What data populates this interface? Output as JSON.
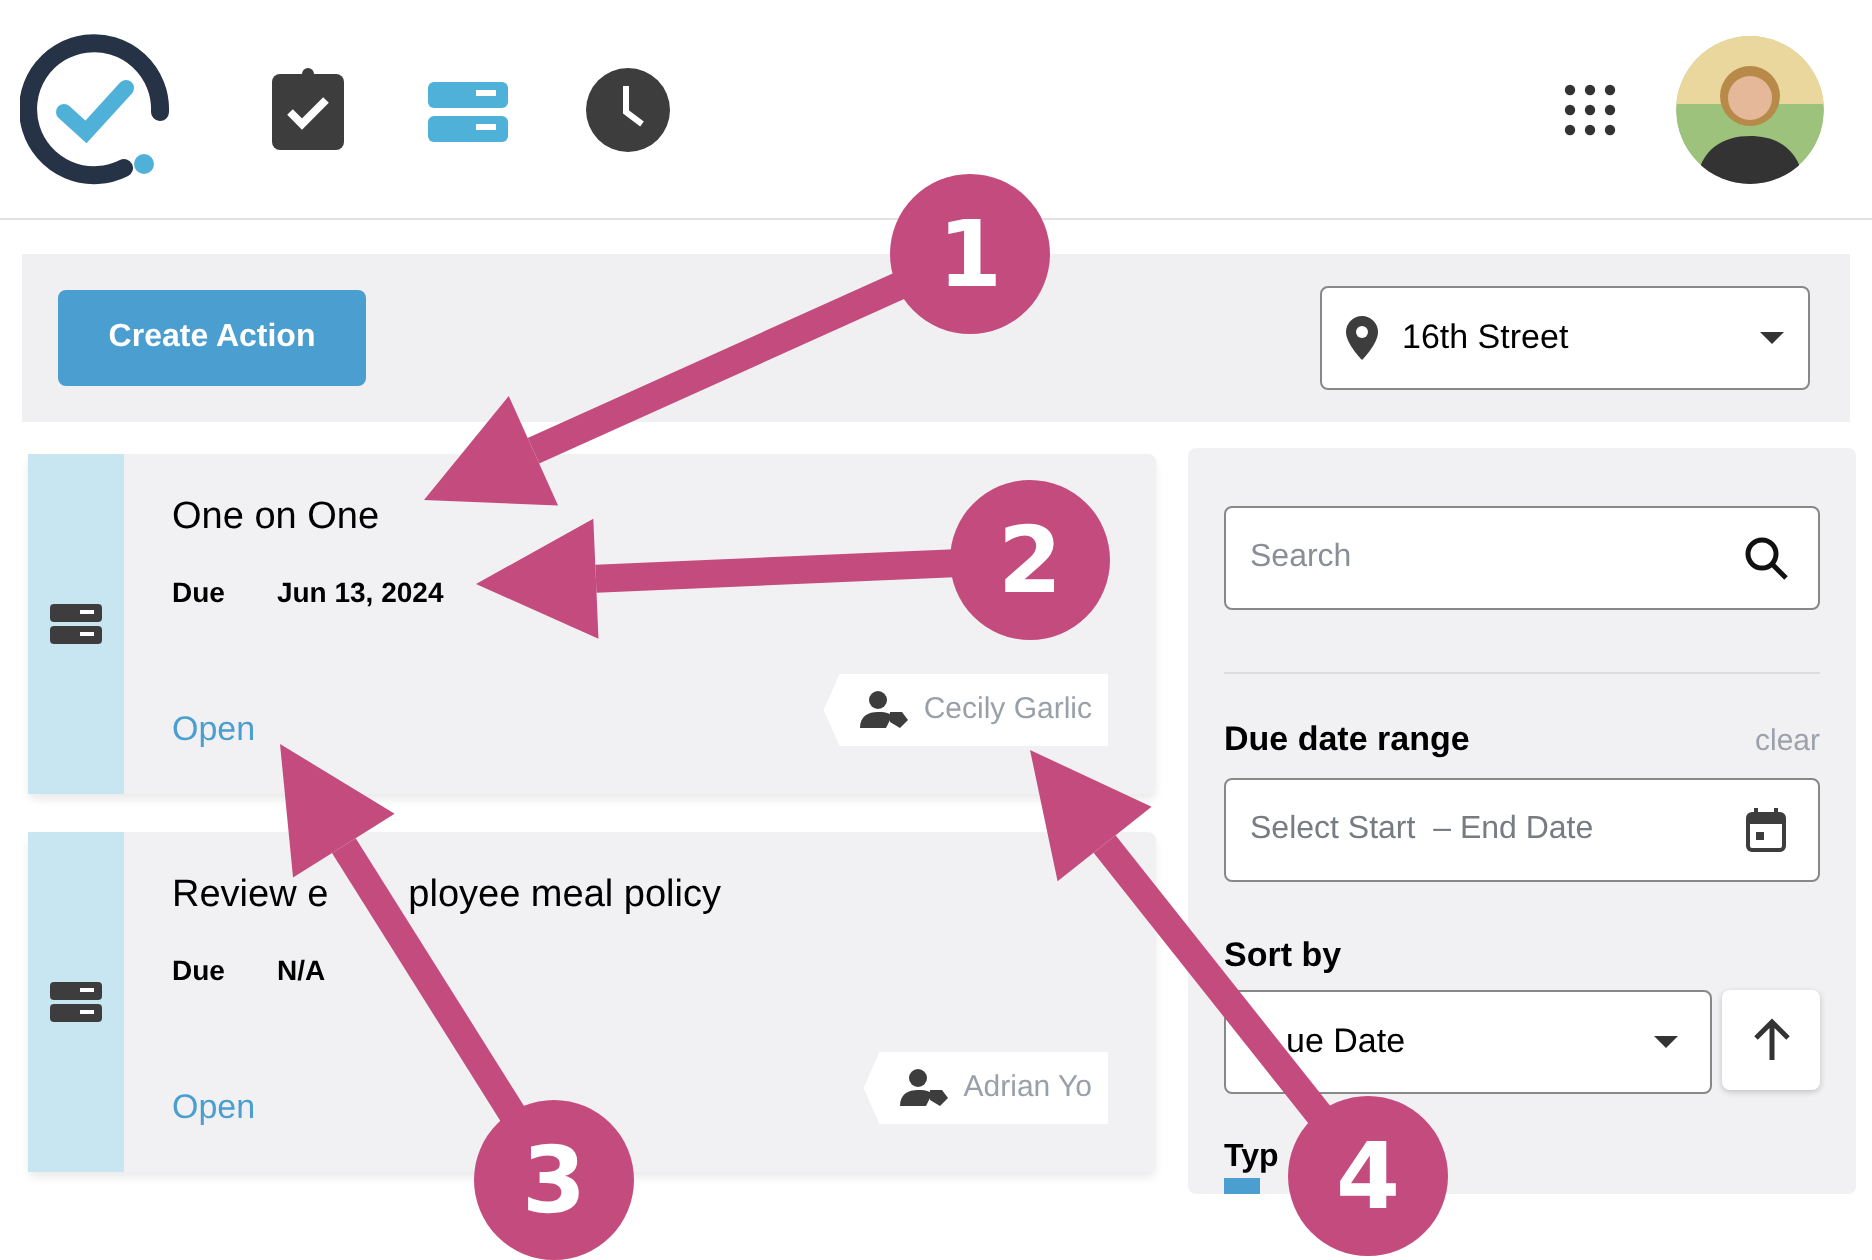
{
  "nav": [
    {
      "kind": "clipboard",
      "selected": false
    },
    {
      "kind": "list",
      "selected": true
    },
    {
      "kind": "clock",
      "selected": false
    }
  ],
  "toolbar": {
    "create_button": "Create Action",
    "location": "16th Street"
  },
  "actions": [
    {
      "title": [
        "One on One"
      ],
      "due_label": "Due",
      "due": "Jun 13, 2024",
      "status": "Open",
      "assignee": "Cecily Garlic"
    },
    {
      "title": [
        "Review e",
        "ployee meal policy"
      ],
      "due_label": "Due",
      "due": "N/A",
      "status": "Open",
      "assignee": "Adrian Yo"
    }
  ],
  "filters": {
    "search_placeholder": "Search",
    "date_range_label": "Due date range",
    "clear": "clear",
    "date_placeholder": "Select Start  – End Date",
    "sort_label": "Sort by",
    "sort_value": "ue Date",
    "type_label": "Typ"
  },
  "callouts": [
    "1",
    "2",
    "3",
    "4"
  ]
}
